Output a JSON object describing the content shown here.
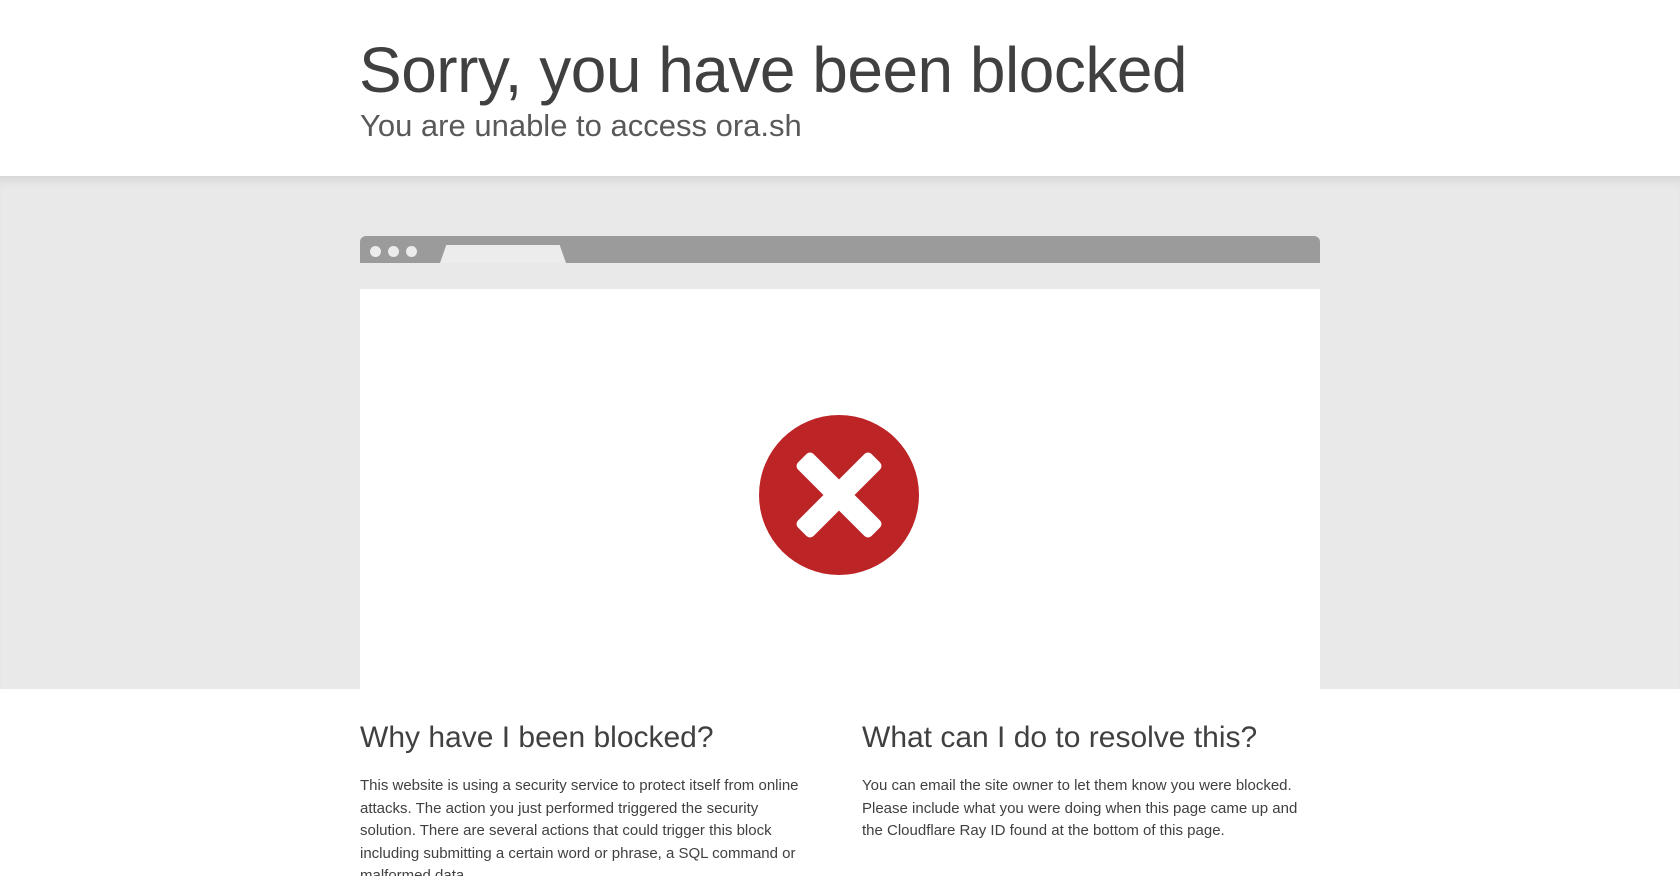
{
  "header": {
    "title": "Sorry, you have been blocked",
    "subtitle": "You are unable to access ora.sh"
  },
  "illustration": {
    "icon": "error-x-icon",
    "icon_color": "#bd2426"
  },
  "why": {
    "heading": "Why have I been blocked?",
    "body": "This website is using a security service to protect itself from online attacks. The action you just performed triggered the security solution. There are several actions that could trigger this block including submitting a certain word or phrase, a SQL command or malformed data."
  },
  "resolve": {
    "heading": "What can I do to resolve this?",
    "body": "You can email the site owner to let them know you were blocked. Please include what you were doing when this page came up and the Cloudflare Ray ID found at the bottom of this page."
  },
  "colors": {
    "band": "#e9e9e9",
    "browser_bar": "#9b9b9b",
    "text": "#404040"
  }
}
